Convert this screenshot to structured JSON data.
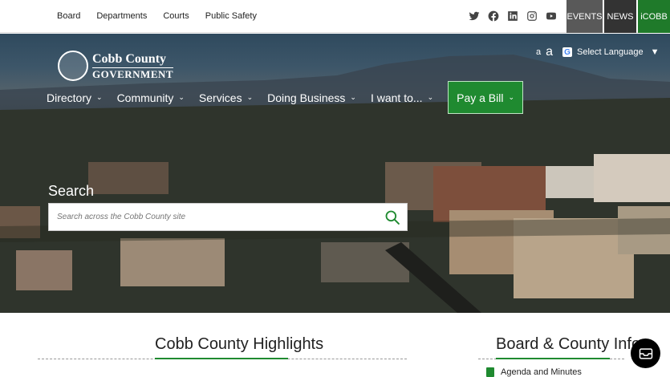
{
  "top_links": [
    "Board",
    "Departments",
    "Courts",
    "Public Safety"
  ],
  "social_icons": [
    "twitter-icon",
    "facebook-icon",
    "linkedin-icon",
    "instagram-icon",
    "youtube-icon"
  ],
  "top_buttons": {
    "events": "EVENTS",
    "news": "NEWS",
    "icobb": "iCOBB"
  },
  "logo": {
    "line1": "Cobb County",
    "line2": "GOVERNMENT"
  },
  "language": {
    "small_a": "a",
    "big_a": "a",
    "label": "Select Language",
    "arrow": "▼"
  },
  "nav": {
    "items": [
      "Directory",
      "Community",
      "Services",
      "Doing Business",
      "I want to..."
    ],
    "pay": "Pay a Bill"
  },
  "search": {
    "label": "Search",
    "placeholder": "Search across the Cobb County site"
  },
  "sections": {
    "highlights": "Cobb County Highlights",
    "board_info": "Board & County Info",
    "agenda": "Agenda and Minutes"
  },
  "colors": {
    "accent_green": "#1f8a30",
    "icobb_green": "#1f7a2a",
    "events_gray": "#595959",
    "news_dark": "#333333"
  }
}
